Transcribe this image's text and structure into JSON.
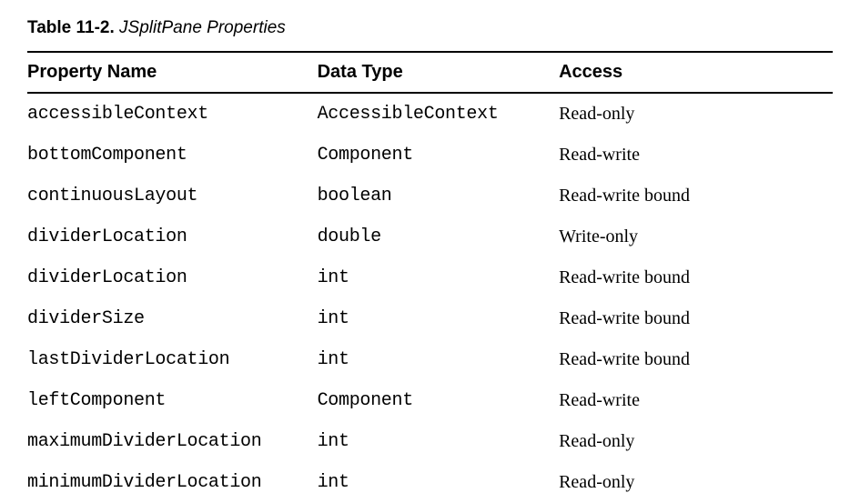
{
  "caption": {
    "label": "Table 11-2.",
    "title": "JSplitPane Properties"
  },
  "columns": [
    "Property Name",
    "Data Type",
    "Access"
  ],
  "rows": [
    {
      "property": "accessibleContext",
      "type": "AccessibleContext",
      "access": "Read-only"
    },
    {
      "property": "bottomComponent",
      "type": "Component",
      "access": "Read-write"
    },
    {
      "property": "continuousLayout",
      "type": "boolean",
      "access": "Read-write bound"
    },
    {
      "property": "dividerLocation",
      "type": "double",
      "access": "Write-only"
    },
    {
      "property": "dividerLocation",
      "type": "int",
      "access": "Read-write bound"
    },
    {
      "property": "dividerSize",
      "type": "int",
      "access": "Read-write bound"
    },
    {
      "property": "lastDividerLocation",
      "type": "int",
      "access": "Read-write bound"
    },
    {
      "property": "leftComponent",
      "type": "Component",
      "access": "Read-write"
    },
    {
      "property": "maximumDividerLocation",
      "type": "int",
      "access": "Read-only"
    },
    {
      "property": "minimumDividerLocation",
      "type": "int",
      "access": "Read-only"
    }
  ]
}
